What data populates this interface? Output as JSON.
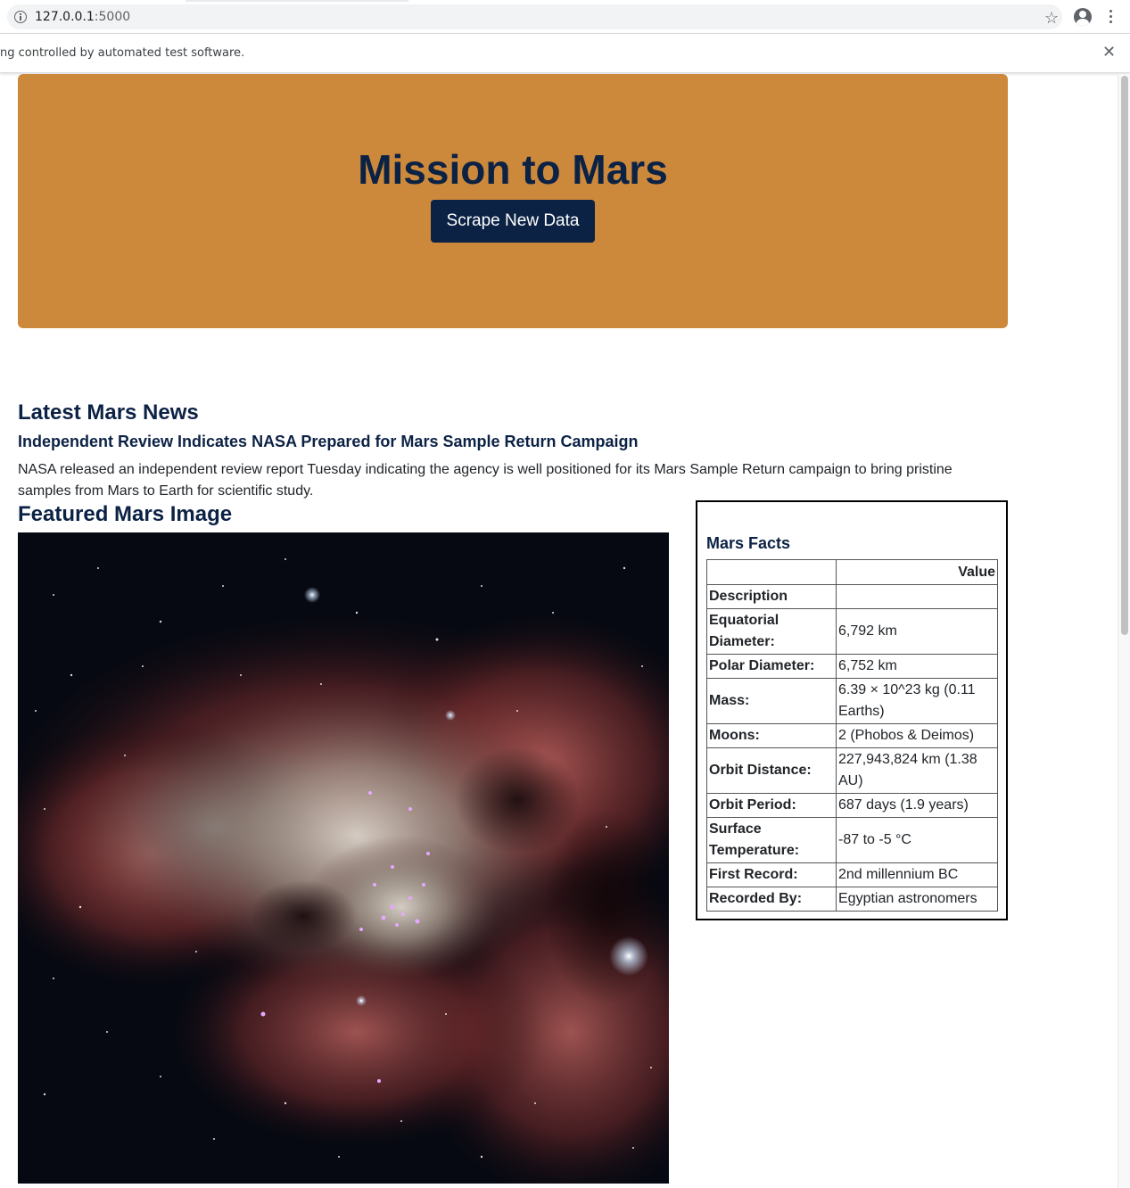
{
  "browser": {
    "url_host": "127.0.0.1",
    "url_port": ":5000",
    "infobar_text": "ng controlled by automated test software.",
    "icons": [
      "info-icon",
      "star-icon",
      "profile-icon",
      "menu-icon",
      "close-icon"
    ]
  },
  "hero": {
    "title": "Mission to Mars",
    "button_label": "Scrape New Data",
    "background_color": "#cd893b",
    "title_color": "#0c2245"
  },
  "news": {
    "heading": "Latest Mars News",
    "title": "Independent Review Indicates NASA Prepared for Mars Sample Return Campaign",
    "paragraph": "NASA released an independent review report Tuesday indicating the agency is well positioned for its Mars Sample Return campaign to bring pristine samples from Mars to Earth for scientific study."
  },
  "featured_image": {
    "heading": "Featured Mars Image"
  },
  "facts": {
    "heading": "Mars Facts",
    "header_blank": "",
    "header_value": "Value",
    "rows": [
      {
        "label": "Description",
        "value": ""
      },
      {
        "label": "Equatorial Diameter:",
        "value": "6,792 km"
      },
      {
        "label": "Polar Diameter:",
        "value": "6,752 km"
      },
      {
        "label": "Mass:",
        "value": "6.39 × 10^23 kg (0.11 Earths)"
      },
      {
        "label": "Moons:",
        "value": "2 (Phobos & Deimos)"
      },
      {
        "label": "Orbit Distance:",
        "value": "227,943,824 km (1.38 AU)"
      },
      {
        "label": "Orbit Period:",
        "value": "687 days (1.9 years)"
      },
      {
        "label": "Surface Temperature:",
        "value": "-87 to -5 °C"
      },
      {
        "label": "First Record:",
        "value": "2nd millennium BC"
      },
      {
        "label": "Recorded By:",
        "value": "Egyptian astronomers"
      }
    ]
  }
}
